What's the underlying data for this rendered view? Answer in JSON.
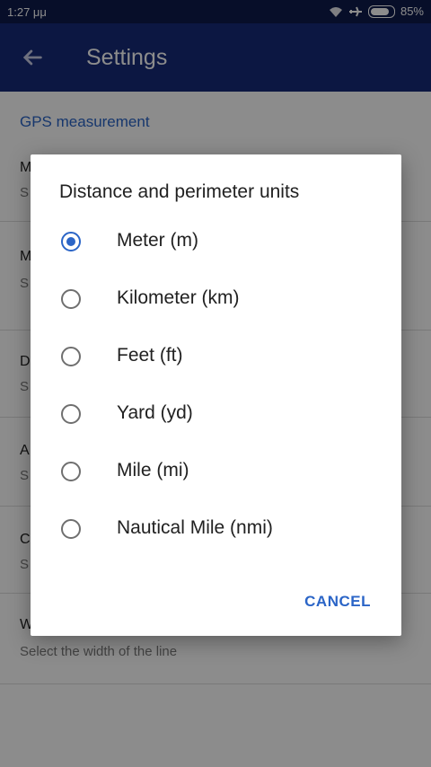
{
  "status_bar": {
    "time": "1:27 μμ",
    "battery": "85%",
    "battery_level_percent": 85,
    "icons": [
      "wifi-icon",
      "airplane-icon",
      "battery-icon"
    ]
  },
  "app_bar": {
    "title": "Settings",
    "back_icon": "arrow-left-icon"
  },
  "background": {
    "section_title": "GPS measurement",
    "last_row": {
      "title_initial": "W",
      "subtitle": "Select the width of the line"
    },
    "row_initials": [
      "M",
      "M",
      "D",
      "A",
      "C"
    ],
    "row_sub_initials": [
      "S",
      "S",
      "S",
      "S",
      "S"
    ]
  },
  "dialog": {
    "title": "Distance and perimeter units",
    "options": [
      {
        "label": "Meter (m)",
        "selected": true
      },
      {
        "label": "Kilometer (km)",
        "selected": false
      },
      {
        "label": "Feet (ft)",
        "selected": false
      },
      {
        "label": "Yard (yd)",
        "selected": false
      },
      {
        "label": "Mile (mi)",
        "selected": false
      },
      {
        "label": "Nautical Mile (nmi)",
        "selected": false
      }
    ],
    "cancel_label": "CANCEL"
  },
  "colors": {
    "status_bar": "#0e1a4b",
    "app_bar": "#172a78",
    "accent": "#2b65c7"
  }
}
